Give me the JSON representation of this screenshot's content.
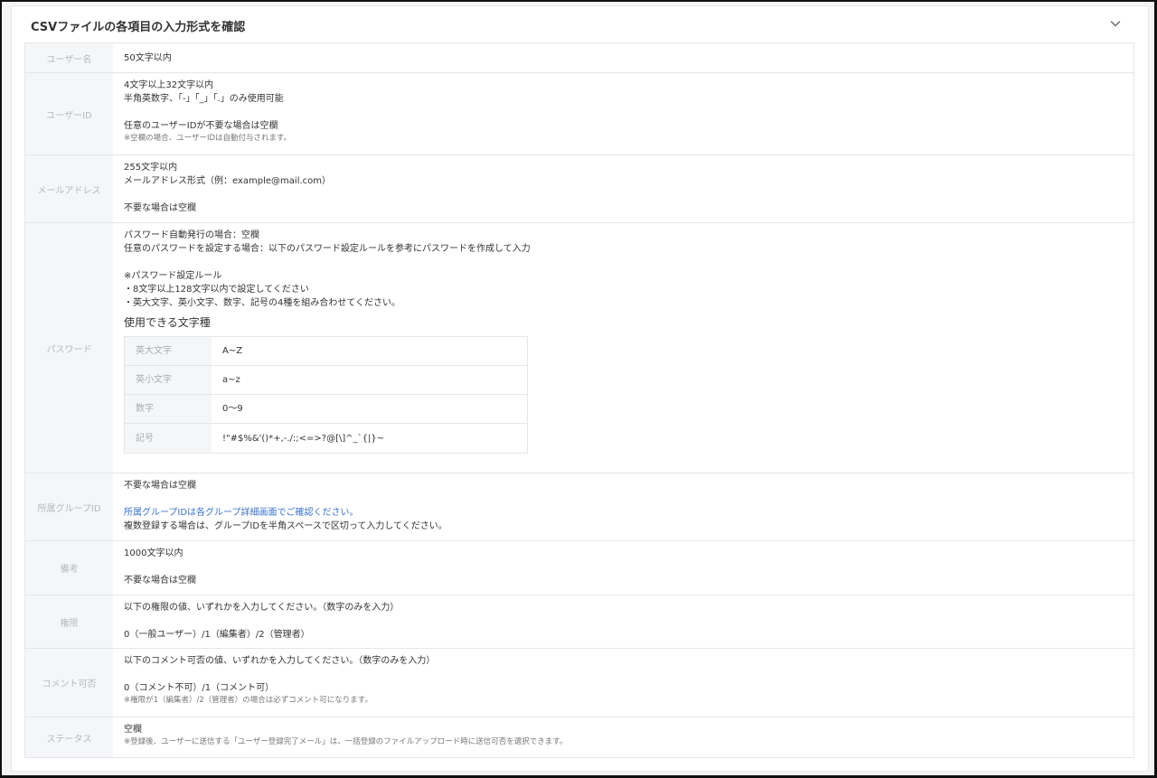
{
  "panel": {
    "title": "CSVファイルの各項目の入力形式を確認",
    "collapse_icon": "chevron-down-icon"
  },
  "rows": {
    "username": {
      "label": "ユーザー名",
      "lines": [
        "50文字以内"
      ]
    },
    "userid": {
      "label": "ユーザーID",
      "lines": [
        "4文字以上32文字以内",
        "半角英数字、「-」「_」「.」のみ使用可能",
        "",
        "任意のユーザーIDが不要な場合は空欄"
      ],
      "note": "※空欄の場合、ユーザーIDは自動付与されます。"
    },
    "email": {
      "label": "メールアドレス",
      "lines": [
        "255文字以内",
        "メールアドレス形式（例：example@mail.com）",
        "",
        "不要な場合は空欄"
      ]
    },
    "password": {
      "label": "パスワード",
      "lines": [
        "パスワード自動発行の場合：空欄",
        "任意のパスワードを設定する場合：以下のパスワード設定ルールを参考にパスワードを作成して入力",
        "",
        "※パスワード設定ルール",
        "・8文字以上128文字以内で設定してください",
        "・英大文字、英小文字、数字、記号の4種を組み合わせてください。"
      ],
      "chars_heading": "使用できる文字種",
      "chars": [
        {
          "label": "英大文字",
          "value": "A~Z"
        },
        {
          "label": "英小文字",
          "value": "a~z"
        },
        {
          "label": "数字",
          "value": "0〜9"
        },
        {
          "label": "記号",
          "value": "!\"#$%&'()*+,-./:;<=>?@[\\]^_`{|}~"
        }
      ]
    },
    "group": {
      "label": "所属グループID",
      "line1": "不要な場合は空欄",
      "link": "所属グループIDは各グループ詳細画面でご確認ください。",
      "line2": "複数登録する場合は、グループIDを半角スペースで区切って入力してください。"
    },
    "remarks": {
      "label": "備考",
      "lines": [
        "1000文字以内",
        "",
        "不要な場合は空欄"
      ]
    },
    "permission": {
      "label": "権限",
      "lines": [
        "以下の権限の値、いずれかを入力してください。（数字のみを入力）",
        "",
        "0（一般ユーザー）/1（編集者）/2（管理者）"
      ]
    },
    "comment": {
      "label": "コメント可否",
      "lines": [
        "以下のコメント可否の値、いずれかを入力してください。（数字のみを入力）",
        "",
        "0（コメント不可）/1（コメント可）"
      ],
      "note": "※権限が1（編集者）/2（管理者）の場合は必ずコメント可になります。"
    },
    "status": {
      "label": "ステータス",
      "lines": [
        "空欄"
      ],
      "note": "※登録後、ユーザーに送信する「ユーザー登録完了メール」は、一括登録のファイルアップロード時に送信可否を選択できます。"
    }
  }
}
